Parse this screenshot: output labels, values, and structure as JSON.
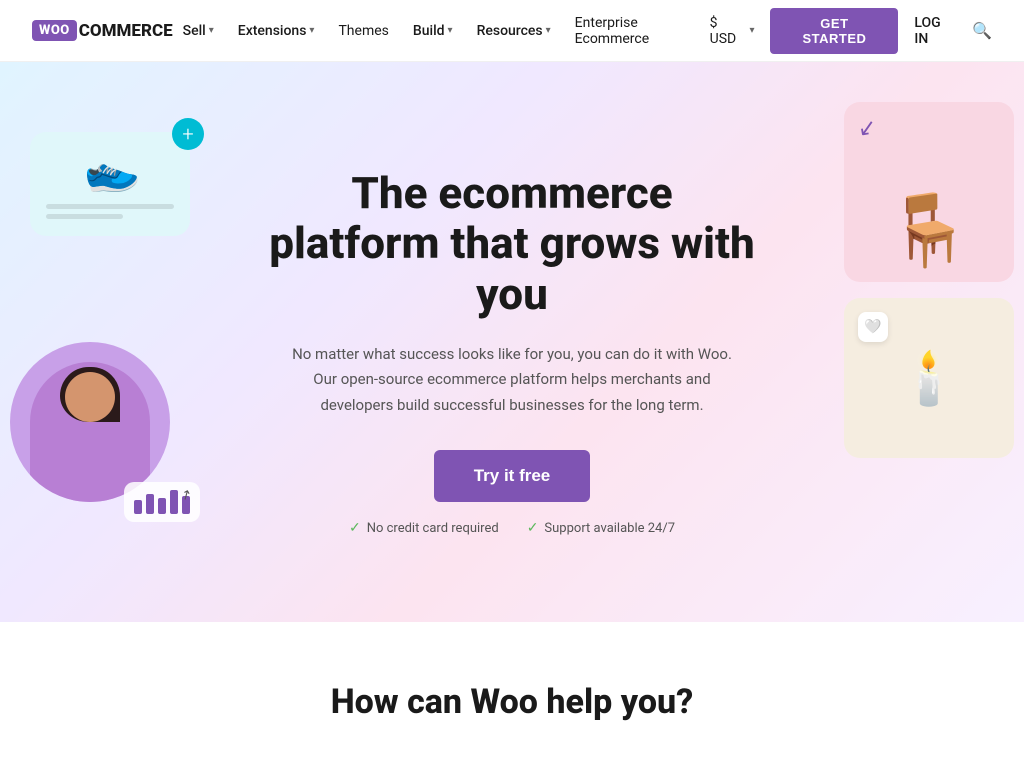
{
  "nav": {
    "logo_woo": "WOO",
    "logo_commerce": "COMMERCE",
    "links": [
      {
        "label": "Sell",
        "has_dropdown": true
      },
      {
        "label": "Extensions",
        "has_dropdown": true
      },
      {
        "label": "Themes",
        "has_dropdown": false
      },
      {
        "label": "Build",
        "has_dropdown": true
      },
      {
        "label": "Resources",
        "has_dropdown": true
      },
      {
        "label": "Enterprise Ecommerce",
        "has_dropdown": false
      }
    ],
    "currency": "$ USD",
    "get_started": "GET STARTED",
    "login": "LOG IN"
  },
  "hero": {
    "title": "The ecommerce platform that grows with you",
    "description": "No matter what success looks like for you, you can do it with Woo. Our open-source ecommerce platform helps merchants and developers build successful businesses for the long term.",
    "cta": "Try it free",
    "feature1": "No credit card required",
    "feature2": "Support available 24/7"
  },
  "bottom": {
    "title": "How can Woo help you?"
  },
  "colors": {
    "purple": "#7f54b3",
    "green": "#5cb85c"
  }
}
